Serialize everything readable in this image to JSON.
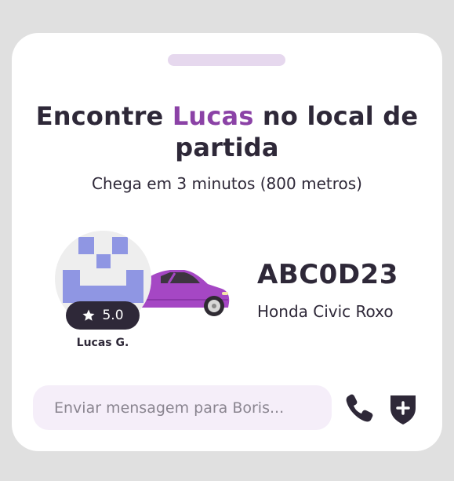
{
  "header": {
    "title_prefix": "Encontre ",
    "title_highlight": "Lucas",
    "title_suffix": " no local de partida",
    "subtitle": "Chega em 3 minutos (800 metros)"
  },
  "driver": {
    "name": "Lucas G.",
    "rating": "5.0",
    "rating_icon": "star-icon",
    "avatar_icon": "pixel-avatar"
  },
  "vehicle": {
    "plate": "ABC0D23",
    "model": "Honda Civic Roxo",
    "color": "#a547c4"
  },
  "actions": {
    "message_placeholder": "Enviar mensagem para Boris...",
    "call_icon": "phone-icon",
    "safety_icon": "shield-plus-icon"
  },
  "colors": {
    "accent": "#8b42a6",
    "text": "#2e2838",
    "input_background": "#f5eef9",
    "handle": "#e6d8ee"
  }
}
